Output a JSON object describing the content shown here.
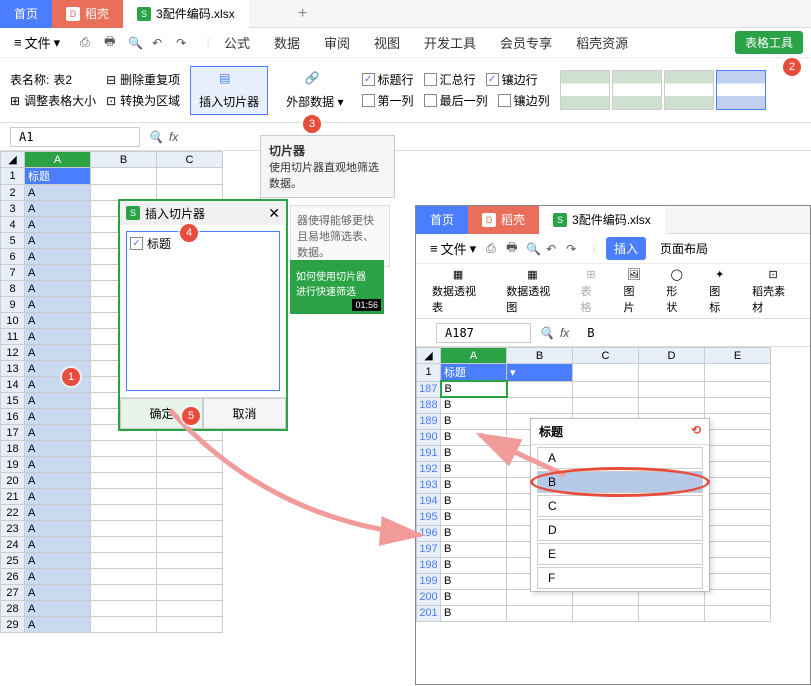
{
  "top_tabs": {
    "home": "首页",
    "docshell": "稻壳",
    "filename": "3配件编码.xlsx",
    "plus": "+"
  },
  "menu": {
    "file": "文件",
    "tabs": [
      "公式",
      "数据",
      "审阅",
      "视图",
      "开发工具",
      "会员专享",
      "稻壳资源"
    ],
    "tools_btn": "表格工具"
  },
  "ribbon": {
    "table_name_label": "表名称:",
    "table_name_value": "表2",
    "resize": "调整表格大小",
    "dedup": "删除重复项",
    "to_range": "转换为区域",
    "insert_slicer": "插入切片器",
    "ext_data": "外部数据",
    "cb_header": "标题行",
    "cb_total": "汇总行",
    "cb_banded": "镶边行",
    "cb_first": "第一列",
    "cb_last": "最后一列",
    "cb_bandcol": "镶边列"
  },
  "cellref": {
    "value": "A1"
  },
  "tooltip": {
    "title": "切片器",
    "desc": "使用切片器直观地筛选数据。"
  },
  "tippanel": "器使得能够更快且易地筛选表、数据。",
  "greencard": {
    "line1": "如何使用切片器",
    "line2": "进行快速筛选",
    "time": "01:56"
  },
  "sheet": {
    "cols": [
      "A",
      "B",
      "C"
    ],
    "header_cell": "标题",
    "rows": 29,
    "cell_value": "A"
  },
  "dialog": {
    "title": "插入切片器",
    "item": "标题",
    "ok": "确定",
    "cancel": "取消"
  },
  "win2": {
    "tabs": {
      "home": "首页",
      "docshell": "稻壳",
      "filename": "3配件编码.xlsx"
    },
    "menu_file": "文件",
    "insert_btn": "插入",
    "page_layout": "页面布局",
    "toolbar": [
      "数据透视表",
      "数据透视图",
      "表格",
      "图片",
      "形状",
      "图标",
      "稻壳素材"
    ],
    "cellref": "A187",
    "fx_value": "B",
    "header_cell": "标题",
    "cols": [
      "A",
      "B",
      "C",
      "D",
      "E"
    ],
    "rows": [
      1,
      187,
      188,
      189,
      190,
      191,
      192,
      193,
      194,
      195,
      196,
      197,
      198,
      199,
      200,
      201
    ],
    "cell_value": "B"
  },
  "slicer": {
    "title": "标题",
    "items": [
      "A",
      "B",
      "C",
      "D",
      "E",
      "F"
    ],
    "selected": "B"
  },
  "badges": [
    "1",
    "2",
    "3",
    "4",
    "5"
  ]
}
